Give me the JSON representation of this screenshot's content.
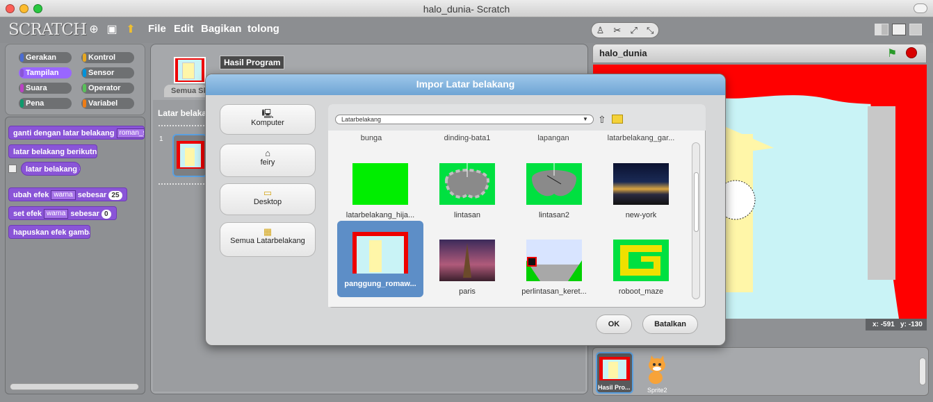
{
  "window": {
    "title": "halo_dunia- Scratch"
  },
  "menubar": {
    "logo": "SCRATCH",
    "icons": [
      "globe-icon",
      "save-icon",
      "share-icon"
    ],
    "menus": [
      "File",
      "Edit",
      "Bagikan",
      "tolong"
    ],
    "tools": [
      "stamp-icon",
      "scissors-icon",
      "grow-icon",
      "shrink-icon"
    ]
  },
  "categories": [
    {
      "label": "Gerakan",
      "color": "#4a6cd4"
    },
    {
      "label": "Kontrol",
      "color": "#e6a822"
    },
    {
      "label": "Tampilan",
      "color": "#8a55d7",
      "selected": true
    },
    {
      "label": "Sensor",
      "color": "#0093db"
    },
    {
      "label": "Suara",
      "color": "#bb42c3"
    },
    {
      "label": "Operator",
      "color": "#59c059"
    },
    {
      "label": "Pena",
      "color": "#0e9a6c"
    },
    {
      "label": "Variabel",
      "color": "#ee7d16"
    }
  ],
  "blocks": {
    "b1_label": "ganti dengan latar belakang",
    "b1_value": "roman_stag",
    "b2_label": "latar belakang berikutnya",
    "b3_label": "latar belakang #",
    "b4_label": "ubah efek",
    "b4_dd": "warna",
    "b4_mid": "sebesar",
    "b4_val": "25",
    "b5_label": "set efek",
    "b5_dd": "warna",
    "b5_mid": "sebesar",
    "b5_val": "0",
    "b6_label": "hapuskan efek gambar"
  },
  "center": {
    "sprite_name": "Hasil Program",
    "tab_label": "Semua Sk",
    "section_label": "Latar belakang",
    "bg_number": "1"
  },
  "stage": {
    "name": "halo_dunia",
    "x_label": "x:",
    "x_value": "-591",
    "y_label": "y:",
    "y_value": "-130"
  },
  "sprites": [
    {
      "label": "Hasil Pro..."
    },
    {
      "label": "Sprite2"
    }
  ],
  "dialog": {
    "title": "Impor Latar belakang",
    "sidebar": [
      {
        "label": "Komputer",
        "icon": "computer-icon"
      },
      {
        "label": "feiry",
        "icon": "home-icon"
      },
      {
        "label": "Desktop",
        "icon": "folder-icon"
      },
      {
        "label": "Semua Latarbelakang",
        "icon": "backgrounds-icon"
      }
    ],
    "folder": "Latarbelakang",
    "top_row": [
      "bunga",
      "dinding-bata1",
      "lapangan",
      "latarbelakang_gar..."
    ],
    "items": [
      {
        "label": "latarbelakang_hija..."
      },
      {
        "label": "lintasan"
      },
      {
        "label": "lintasan2"
      },
      {
        "label": "new-york"
      },
      {
        "label": "panggung_romaw...",
        "selected": true
      },
      {
        "label": "paris"
      },
      {
        "label": "perlintasan_keret..."
      },
      {
        "label": "roboot_maze"
      }
    ],
    "ok_label": "OK",
    "cancel_label": "Batalkan"
  }
}
